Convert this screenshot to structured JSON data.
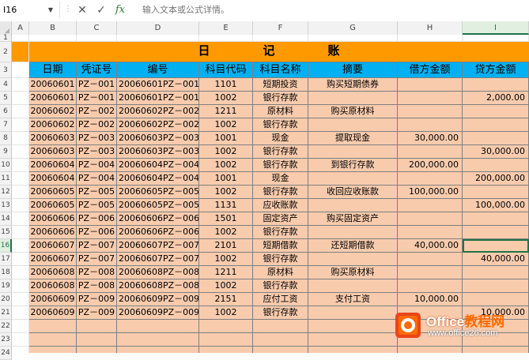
{
  "formula_bar": {
    "name_box": "I16",
    "cancel_icon": "close-icon",
    "enter_icon": "check-icon",
    "function_icon": "fx",
    "placeholder": "输入文本或公式详情。"
  },
  "column_headers": [
    "A",
    "B",
    "C",
    "D",
    "E",
    "F",
    "G",
    "H",
    "I"
  ],
  "row_numbers": [
    "1",
    "2",
    "3",
    "4",
    "5",
    "6",
    "7",
    "8",
    "9",
    "10",
    "11",
    "12",
    "13",
    "14",
    "15",
    "16",
    "17",
    "18",
    "19",
    "20",
    "21",
    "22",
    "23",
    "24"
  ],
  "sheet": {
    "title": "日　记　账",
    "headers": [
      "日期",
      "凭证号",
      "编号",
      "科目代码",
      "科目名称",
      "摘要",
      "借方金额",
      "贷方金额"
    ],
    "rows": [
      [
        "20060601",
        "PZ－001",
        "20060601PZ－001",
        "1101",
        "短期投资",
        "购买短期债券",
        "",
        ""
      ],
      [
        "20060601",
        "PZ－001",
        "20060601PZ－001",
        "1002",
        "银行存款",
        "",
        "",
        "2,000.00"
      ],
      [
        "20060602",
        "PZ－002",
        "20060602PZ－002",
        "1211",
        "原材料",
        "购买原材料",
        "",
        ""
      ],
      [
        "20060602",
        "PZ－002",
        "20060602PZ－002",
        "1002",
        "银行存款",
        "",
        "",
        ""
      ],
      [
        "20060603",
        "PZ－003",
        "20060603PZ－003",
        "1001",
        "现金",
        "提取现金",
        "30,000.00",
        ""
      ],
      [
        "20060603",
        "PZ－003",
        "20060603PZ－003",
        "1002",
        "银行存款",
        "",
        "",
        "30,000.00"
      ],
      [
        "20060604",
        "PZ－004",
        "20060604PZ－004",
        "1002",
        "银行存款",
        "到银行存款",
        "200,000.00",
        ""
      ],
      [
        "20060604",
        "PZ－004",
        "20060604PZ－004",
        "1001",
        "现金",
        "",
        "",
        "200,000.00"
      ],
      [
        "20060605",
        "PZ－005",
        "20060605PZ－005",
        "1002",
        "银行存款",
        "收回应收账款",
        "100,000.00",
        ""
      ],
      [
        "20060605",
        "PZ－005",
        "20060605PZ－005",
        "1131",
        "应收账款",
        "",
        "",
        "100,000.00"
      ],
      [
        "20060606",
        "PZ－006",
        "20060606PZ－006",
        "1501",
        "固定资产",
        "购买固定资产",
        "",
        ""
      ],
      [
        "20060606",
        "PZ－006",
        "20060606PZ－006",
        "1002",
        "银行存款",
        "",
        "",
        ""
      ],
      [
        "20060607",
        "PZ－007",
        "20060607PZ－007",
        "2101",
        "短期借款",
        "还短期借款",
        "40,000.00",
        ""
      ],
      [
        "20060607",
        "PZ－007",
        "20060607PZ－007",
        "1002",
        "银行存款",
        "",
        "",
        "40,000.00"
      ],
      [
        "20060608",
        "PZ－008",
        "20060608PZ－008",
        "1211",
        "原材料",
        "购买原材料",
        "",
        ""
      ],
      [
        "20060608",
        "PZ－008",
        "20060608PZ－008",
        "1002",
        "银行存款",
        "",
        "",
        ""
      ],
      [
        "20060609",
        "PZ－009",
        "20060609PZ－009",
        "2151",
        "应付工资",
        "支付工资",
        "10,000.00",
        ""
      ],
      [
        "20060609",
        "PZ－009",
        "20060609PZ－009",
        "1002",
        "银行存款",
        "",
        "",
        "10,000.00"
      ]
    ]
  },
  "selected_cell": "I16",
  "watermark": {
    "title_white": "Office",
    "title_orange": "教程网",
    "url": "www.office26.com"
  },
  "colors": {
    "title_fill": "#ff9900",
    "header_fill": "#00b0f0",
    "body_fill": "#f8cbad",
    "accent": "#217346"
  }
}
